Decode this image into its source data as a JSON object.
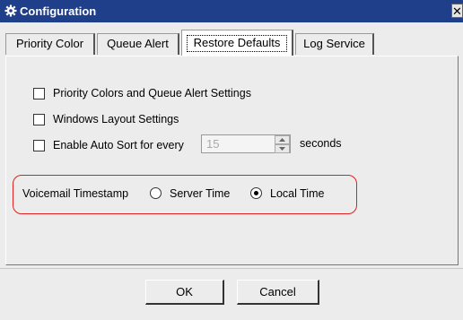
{
  "window": {
    "title": "Configuration",
    "close_glyph": "✕"
  },
  "tabs": [
    {
      "label": "Priority Color",
      "selected": false
    },
    {
      "label": "Queue Alert",
      "selected": false
    },
    {
      "label": "Restore Defaults",
      "selected": true
    },
    {
      "label": "Log Service",
      "selected": false
    }
  ],
  "options": {
    "priority_colors_label": "Priority Colors and Queue Alert Settings",
    "windows_layout_label": "Windows Layout Settings",
    "auto_sort_label": "Enable Auto Sort for every",
    "auto_sort_value": "15",
    "auto_sort_unit": "seconds"
  },
  "voicemail": {
    "label": "Voicemail Timestamp",
    "server_time_label": "Server Time",
    "local_time_label": "Local Time",
    "selected": "Local Time"
  },
  "buttons": {
    "ok_label": "OK",
    "cancel_label": "Cancel"
  },
  "colors": {
    "titlebar": "#1f3f8a",
    "highlight_border": "#e02020"
  },
  "icons": {
    "title_icon": "gear-icon",
    "close": "close-icon",
    "spin_up": "arrow-up-icon",
    "spin_down": "arrow-down-icon"
  }
}
